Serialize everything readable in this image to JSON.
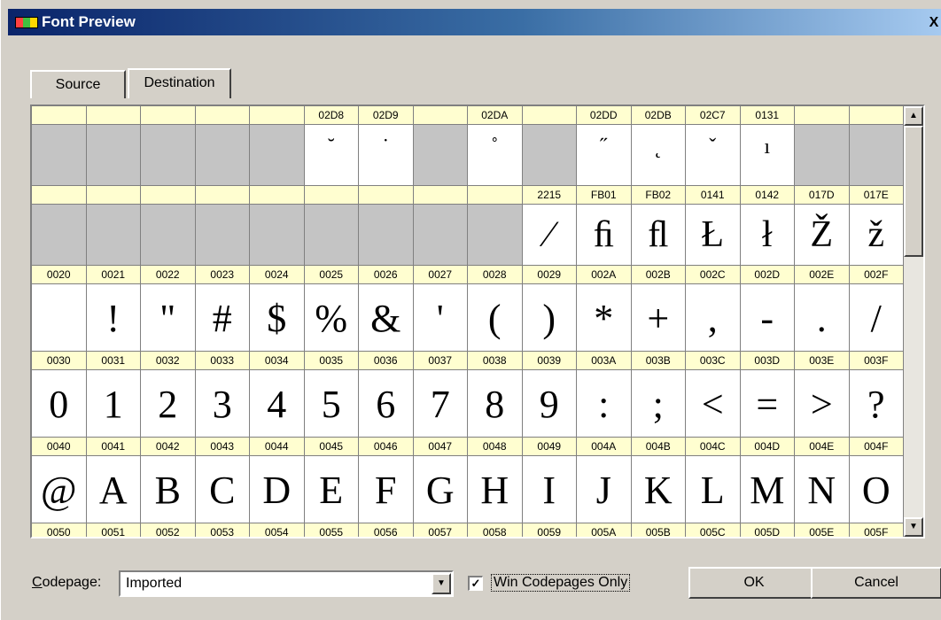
{
  "window": {
    "title": "Font Preview",
    "close_symbol": "X"
  },
  "tabs": [
    {
      "label": "Source"
    },
    {
      "label": "Destination"
    }
  ],
  "grid": {
    "rows": [
      {
        "headers": [
          "",
          "",
          "",
          "",
          "",
          "02D8",
          "02D9",
          "",
          "02DA",
          "",
          "02DD",
          "02DB",
          "02C7",
          "0131",
          "",
          ""
        ],
        "glyphs": [
          "",
          "",
          "",
          "",
          "",
          "˘",
          "˙",
          "",
          "˚",
          "",
          "˝",
          "˛",
          "ˇ",
          "ı",
          "",
          ""
        ]
      },
      {
        "headers": [
          "",
          "",
          "",
          "",
          "",
          "",
          "",
          "",
          "",
          "2215",
          "FB01",
          "FB02",
          "0141",
          "0142",
          "017D",
          "017E"
        ],
        "glyphs": [
          "",
          "",
          "",
          "",
          "",
          "",
          "",
          "",
          "",
          "∕",
          "ﬁ",
          "ﬂ",
          "Ł",
          "ł",
          "Ž",
          "ž"
        ]
      },
      {
        "headers": [
          "0020",
          "0021",
          "0022",
          "0023",
          "0024",
          "0025",
          "0026",
          "0027",
          "0028",
          "0029",
          "002A",
          "002B",
          "002C",
          "002D",
          "002E",
          "002F"
        ],
        "glyphs": [
          "",
          "!",
          "\"",
          "#",
          "$",
          "%",
          "&",
          "'",
          "(",
          ")",
          "*",
          "+",
          ",",
          "-",
          ".",
          "/"
        ]
      },
      {
        "headers": [
          "0030",
          "0031",
          "0032",
          "0033",
          "0034",
          "0035",
          "0036",
          "0037",
          "0038",
          "0039",
          "003A",
          "003B",
          "003C",
          "003D",
          "003E",
          "003F"
        ],
        "glyphs": [
          "0",
          "1",
          "2",
          "3",
          "4",
          "5",
          "6",
          "7",
          "8",
          "9",
          ":",
          ";",
          "<",
          "=",
          ">",
          "?"
        ]
      },
      {
        "headers": [
          "0040",
          "0041",
          "0042",
          "0043",
          "0044",
          "0045",
          "0046",
          "0047",
          "0048",
          "0049",
          "004A",
          "004B",
          "004C",
          "004D",
          "004E",
          "004F"
        ],
        "glyphs": [
          "@",
          "A",
          "B",
          "C",
          "D",
          "E",
          "F",
          "G",
          "H",
          "I",
          "J",
          "K",
          "L",
          "M",
          "N",
          "O"
        ]
      },
      {
        "headers": [
          "0050",
          "0051",
          "0052",
          "0053",
          "0054",
          "0055",
          "0056",
          "0057",
          "0058",
          "0059",
          "005A",
          "005B",
          "005C",
          "005D",
          "005E",
          "005F"
        ],
        "glyphs": [
          "",
          "",
          "",
          "",
          "",
          "",
          "",
          "",
          "",
          "",
          "",
          "",
          "",
          "",
          "",
          ""
        ]
      }
    ]
  },
  "codepage": {
    "label_prefix": "C",
    "label_rest": "odepage:",
    "value": "Imported"
  },
  "win_codepages_only": {
    "label": "Win Codepages Only",
    "checked": true,
    "check_mark": "✓"
  },
  "buttons": {
    "ok": "OK",
    "cancel": "Cancel"
  },
  "icons": {
    "scroll_up": "▲",
    "scroll_down": "▼",
    "dropdown": "▼"
  }
}
